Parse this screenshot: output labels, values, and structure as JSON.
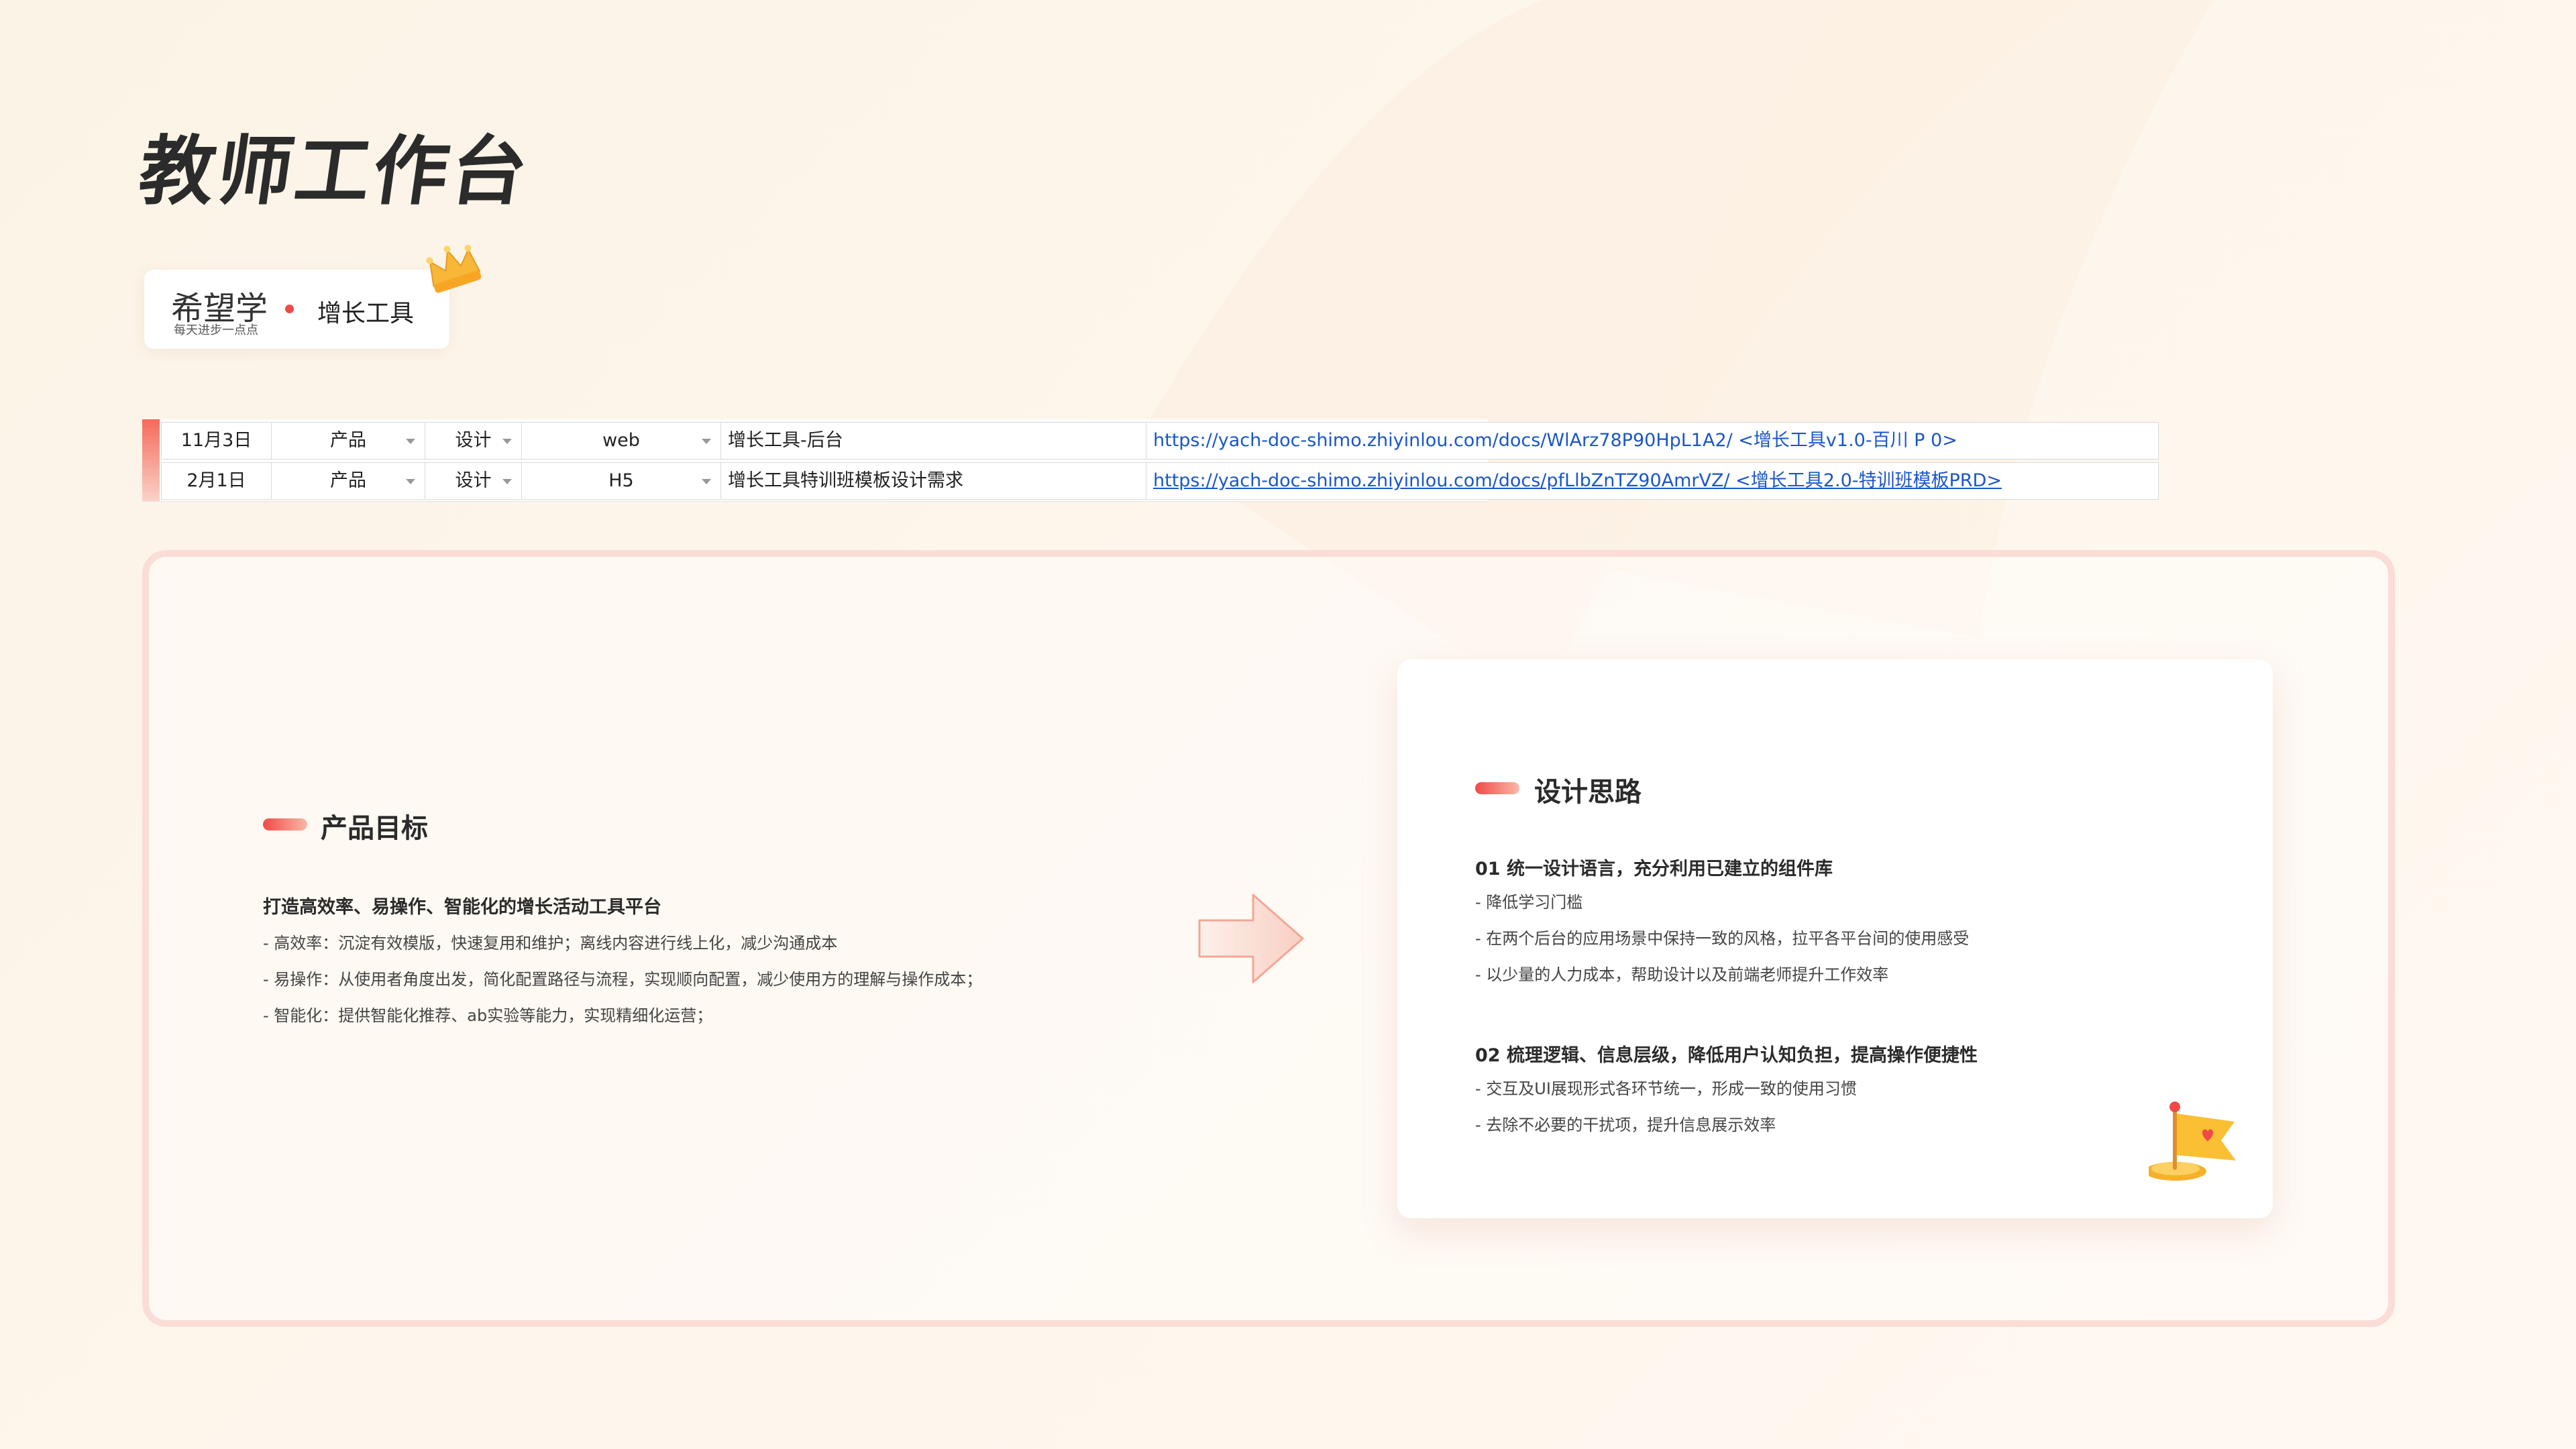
{
  "page": {
    "title": "教师工作台"
  },
  "badge": {
    "brand": "希望学",
    "slogan": "每天进步一点点",
    "tool": "增长工具"
  },
  "sheet": {
    "rows": [
      {
        "date": "11月3日",
        "type": "产品",
        "kind": "设计",
        "platform": "web",
        "name": "增长工具-后台",
        "link": "https://yach-doc-shimo.zhiyinlou.com/docs/WlArz78P90HpL1A2/ <增长工具v1.0-百川 P 0>"
      },
      {
        "date": "2月1日",
        "type": "产品",
        "kind": "设计",
        "platform": "H5",
        "name": "增长工具特训班模板设计需求",
        "link": "https://yach-doc-shimo.zhiyinlou.com/docs/pfLlbZnTZ90AmrVZ/ <增长工具2.0-特训班模板PRD>"
      }
    ]
  },
  "goal": {
    "title": "产品目标",
    "heading": "打造高效率、易操作、智能化的增长活动工具平台",
    "items": [
      "- 高效率：沉淀有效模版，快速复用和维护；离线内容进行线上化，减少沟通成本",
      "- 易操作：从使用者角度出发，简化配置路径与流程，实现顺向配置，减少使用方的理解与操作成本；",
      "- 智能化：提供智能化推荐、ab实验等能力，实现精细化运营；"
    ]
  },
  "design": {
    "title": "设计思路",
    "sections": [
      {
        "heading": "01 统一设计语言，充分利用已建立的组件库",
        "items": [
          "- 降低学习门槛",
          "- 在两个后台的应用场景中保持一致的风格，拉平各平台间的使用感受",
          "- 以少量的人力成本，帮助设计以及前端老师提升工作效率"
        ]
      },
      {
        "heading": "02 梳理逻辑、信息层级，降低用户认知负担，提高操作便捷性",
        "items": [
          "- 交互及UI展现形式各环节统一，形成一致的使用习惯",
          "- 去除不必要的干扰项，提升信息展示效率"
        ]
      }
    ]
  },
  "colors": {
    "accent": "#f04a47",
    "link": "#1a56c8",
    "panel_border": "#fbdcd6"
  },
  "icons": [
    "crown-icon",
    "dropdown-caret-icon",
    "arrow-right-icon",
    "flag-icon"
  ]
}
